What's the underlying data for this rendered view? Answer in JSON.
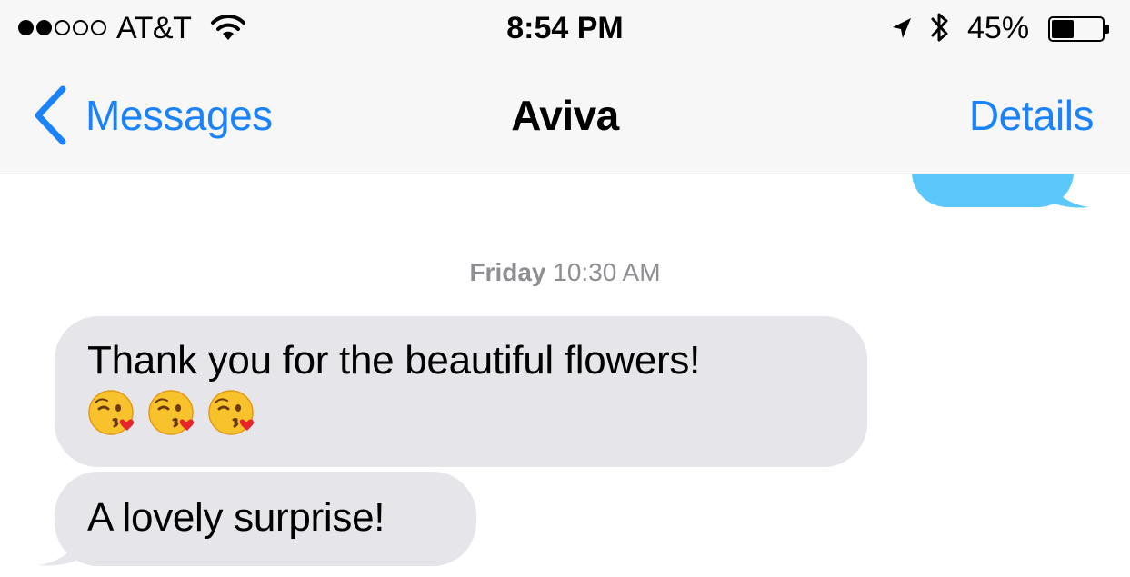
{
  "status_bar": {
    "carrier": "AT&T",
    "time": "8:54 PM",
    "battery_percent": "45%",
    "battery_level": 0.45,
    "signal_bars_filled": 2,
    "signal_bars_total": 5
  },
  "nav": {
    "back_label": "Messages",
    "title": "Aviva",
    "details_label": "Details"
  },
  "conversation": {
    "timestamp_day": "Friday",
    "timestamp_time": "10:30 AM",
    "messages": [
      {
        "direction": "received",
        "text": "Thank you for the beautiful flowers!",
        "emojis": [
          "face-blowing-kiss",
          "face-blowing-kiss",
          "face-blowing-kiss"
        ]
      },
      {
        "direction": "received",
        "text": "A lovely surprise!"
      }
    ]
  },
  "colors": {
    "ios_blue": "#1a82fb",
    "sent_bubble": "#5ac8fa",
    "received_bubble": "#e5e5ea",
    "timestamp_gray": "#8e8e93"
  }
}
